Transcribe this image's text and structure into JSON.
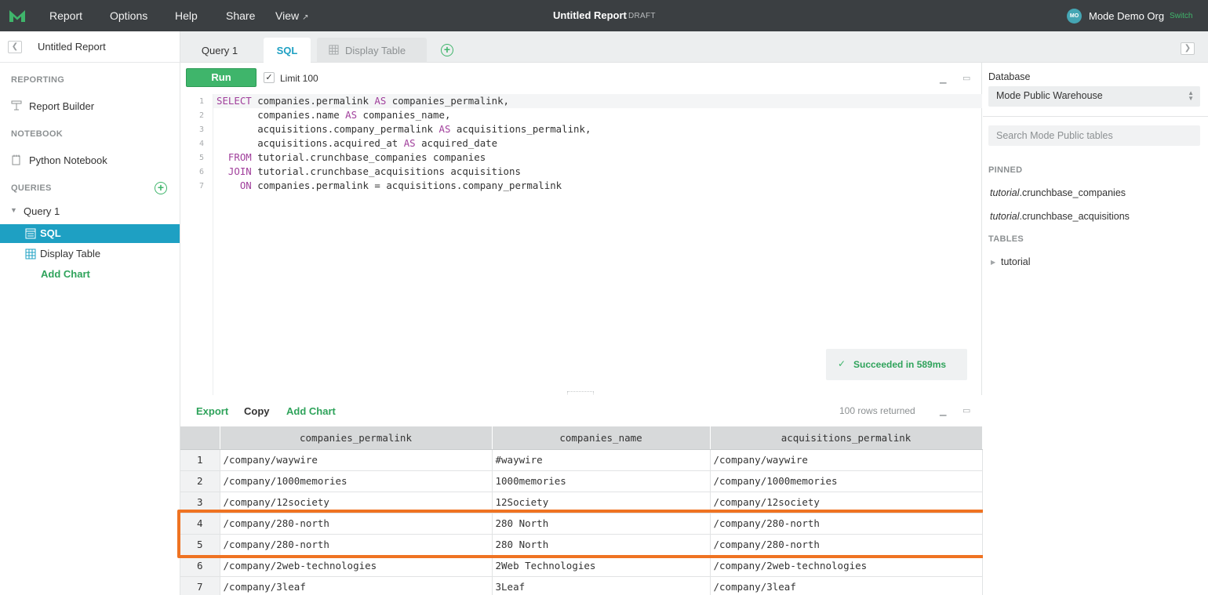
{
  "topbar": {
    "menu": [
      "Report",
      "Options",
      "Help",
      "Share",
      "View"
    ],
    "title": "Untitled Report",
    "draft": "DRAFT",
    "avatar_initials": "MO",
    "org_name": "Mode Demo Org",
    "switch_label": "Switch"
  },
  "sidebar": {
    "report_name": "Untitled Report",
    "reporting_label": "REPORTING",
    "report_builder": "Report Builder",
    "notebook_label": "NOTEBOOK",
    "python_notebook": "Python Notebook",
    "queries_label": "QUERIES",
    "query_name": "Query 1",
    "sql_item": "SQL",
    "display_table_item": "Display Table",
    "add_chart": "Add Chart"
  },
  "tabs": {
    "query": "Query 1",
    "sql": "SQL",
    "display_table": "Display Table"
  },
  "editor": {
    "run_label": "Run",
    "limit_label": "Limit 100",
    "limit_checked": true,
    "lines": [
      [
        {
          "k": true,
          "t": "SELECT"
        },
        {
          "k": false,
          "t": " companies.permalink "
        },
        {
          "k": true,
          "t": "AS"
        },
        {
          "k": false,
          "t": " companies_permalink,"
        }
      ],
      [
        {
          "k": false,
          "t": "       companies.name "
        },
        {
          "k": true,
          "t": "AS"
        },
        {
          "k": false,
          "t": " companies_name,"
        }
      ],
      [
        {
          "k": false,
          "t": "       acquisitions.company_permalink "
        },
        {
          "k": true,
          "t": "AS"
        },
        {
          "k": false,
          "t": " acquisitions_permalink,"
        }
      ],
      [
        {
          "k": false,
          "t": "       acquisitions.acquired_at "
        },
        {
          "k": true,
          "t": "AS"
        },
        {
          "k": false,
          "t": " acquired_date"
        }
      ],
      [
        {
          "k": false,
          "t": "  "
        },
        {
          "k": true,
          "t": "FROM"
        },
        {
          "k": false,
          "t": " tutorial.crunchbase_companies companies"
        }
      ],
      [
        {
          "k": false,
          "t": "  "
        },
        {
          "k": true,
          "t": "JOIN"
        },
        {
          "k": false,
          "t": " tutorial.crunchbase_acquisitions acquisitions"
        }
      ],
      [
        {
          "k": false,
          "t": "    "
        },
        {
          "k": true,
          "t": "ON"
        },
        {
          "k": false,
          "t": " companies.permalink = acquisitions.company_permalink"
        }
      ]
    ],
    "status": "Succeeded in 589ms"
  },
  "results": {
    "export": "Export",
    "copy": "Copy",
    "add_chart": "Add Chart",
    "rows_returned": "100 rows returned",
    "columns": [
      "companies_permalink",
      "companies_name",
      "acquisitions_permalink"
    ],
    "rows": [
      [
        "1",
        "/company/waywire",
        "#waywire",
        "/company/waywire"
      ],
      [
        "2",
        "/company/1000memories",
        "1000memories",
        "/company/1000memories"
      ],
      [
        "3",
        "/company/12society",
        "12Society",
        "/company/12society"
      ],
      [
        "4",
        "/company/280-north",
        "280 North",
        "/company/280-north"
      ],
      [
        "5",
        "/company/280-north",
        "280 North",
        "/company/280-north"
      ],
      [
        "6",
        "/company/2web-technologies",
        "2Web Technologies",
        "/company/2web-technologies"
      ],
      [
        "7",
        "/company/3leaf",
        "3Leaf",
        "/company/3leaf"
      ]
    ]
  },
  "schema": {
    "database_label": "Database",
    "database_value": "Mode Public Warehouse",
    "search_placeholder": "Search Mode Public tables",
    "pinned_label": "PINNED",
    "pinned": [
      {
        "schema": "tutorial",
        "table": ".crunchbase_companies"
      },
      {
        "schema": "tutorial",
        "table": ".crunchbase_acquisitions"
      }
    ],
    "tables_label": "TABLES",
    "tables": [
      "tutorial"
    ]
  },
  "colors": {
    "accent_green": "#3fb56b",
    "accent_blue": "#1ea0c3",
    "highlight_orange": "#ef7322",
    "topbar": "#3b3f42"
  }
}
